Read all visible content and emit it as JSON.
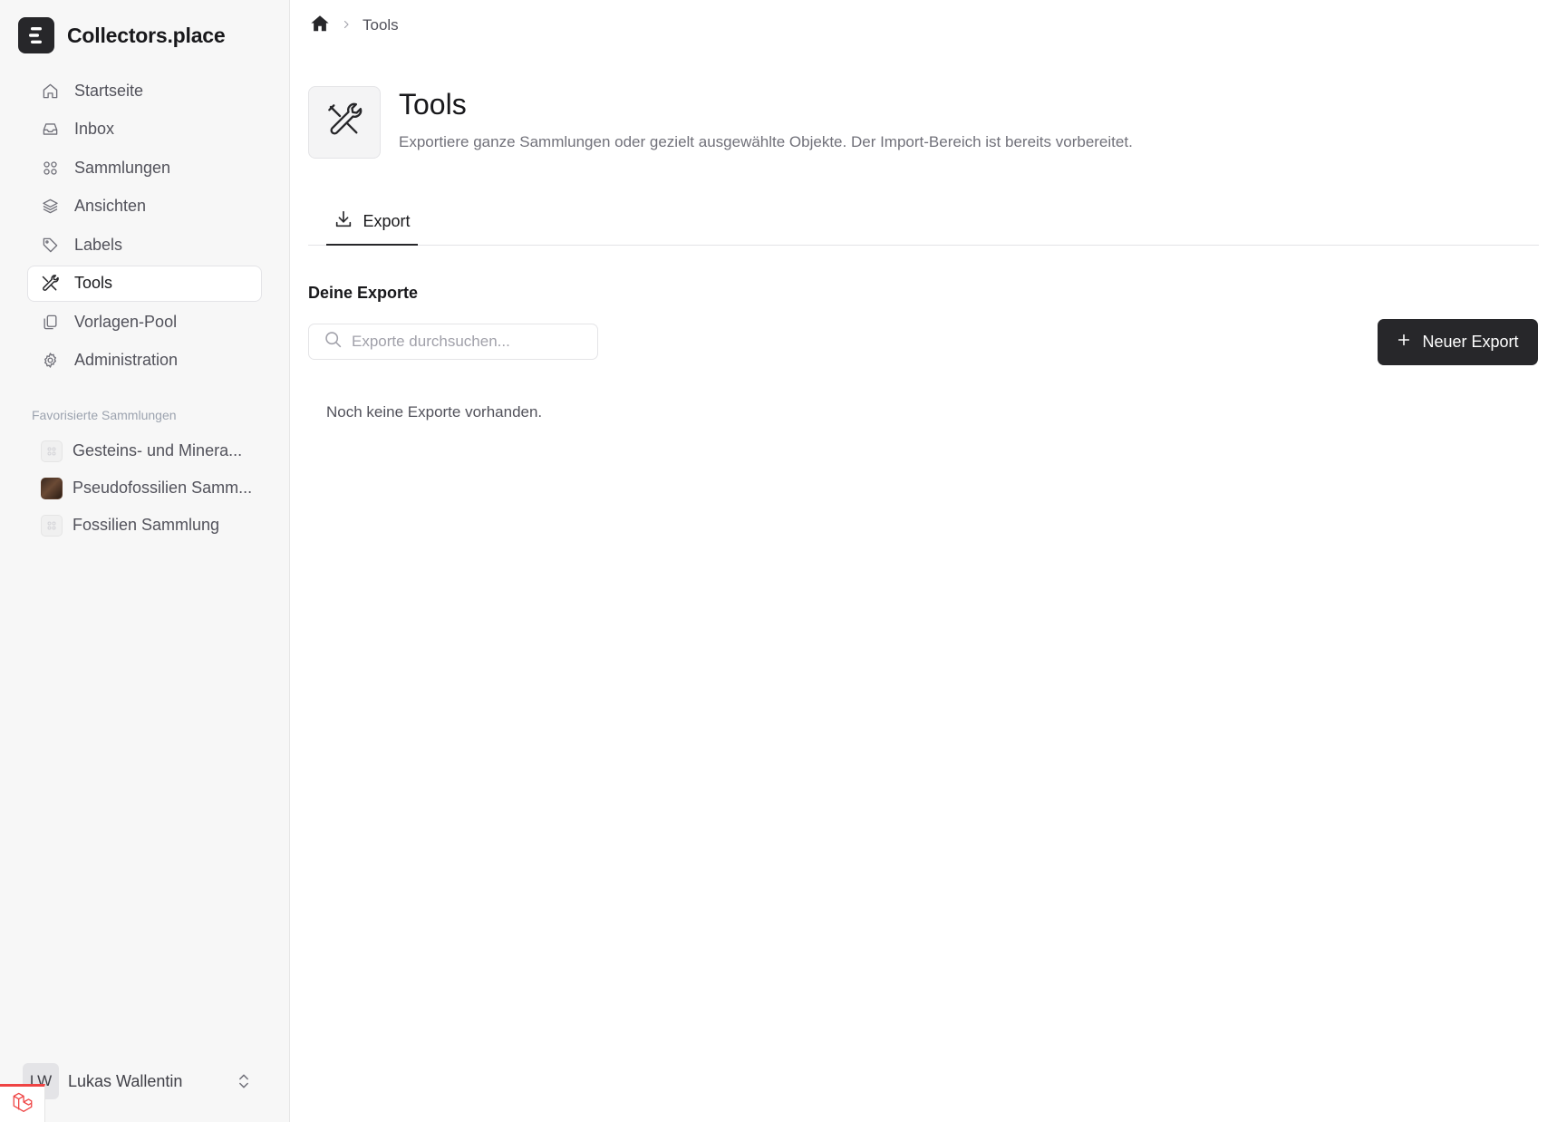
{
  "app": {
    "name": "Collectors.place"
  },
  "sidebar": {
    "items": [
      {
        "label": "Startseite",
        "icon": "home-icon"
      },
      {
        "label": "Inbox",
        "icon": "inbox-icon"
      },
      {
        "label": "Sammlungen",
        "icon": "grid-icon"
      },
      {
        "label": "Ansichten",
        "icon": "layers-icon"
      },
      {
        "label": "Labels",
        "icon": "tag-icon"
      },
      {
        "label": "Tools",
        "icon": "tools-icon",
        "active": true
      },
      {
        "label": "Vorlagen-Pool",
        "icon": "copy-icon"
      },
      {
        "label": "Administration",
        "icon": "gear-icon"
      }
    ],
    "favorites_heading": "Favorisierte Sammlungen",
    "favorites": [
      {
        "label": "Gesteins- und Minera..."
      },
      {
        "label": "Pseudofossilien Samm..."
      },
      {
        "label": "Fossilien Sammlung"
      }
    ],
    "user": {
      "initials": "LW",
      "name": "Lukas Wallentin"
    }
  },
  "breadcrumb": {
    "current": "Tools"
  },
  "page": {
    "title": "Tools",
    "description": "Exportiere ganze Sammlungen oder gezielt ausgewählte Objekte. Der Import-Bereich ist bereits vorbereitet."
  },
  "tabs": [
    {
      "label": "Export",
      "icon": "download-icon",
      "active": true
    }
  ],
  "exports": {
    "section_title": "Deine Exporte",
    "search_placeholder": "Exporte durchsuchen...",
    "new_button_label": "Neuer Export",
    "empty_text": "Noch keine Exporte vorhanden."
  },
  "colors": {
    "accent": "#27272a",
    "sidebar_bg": "#f7f7f7",
    "dev_badge": "#ef4444"
  }
}
